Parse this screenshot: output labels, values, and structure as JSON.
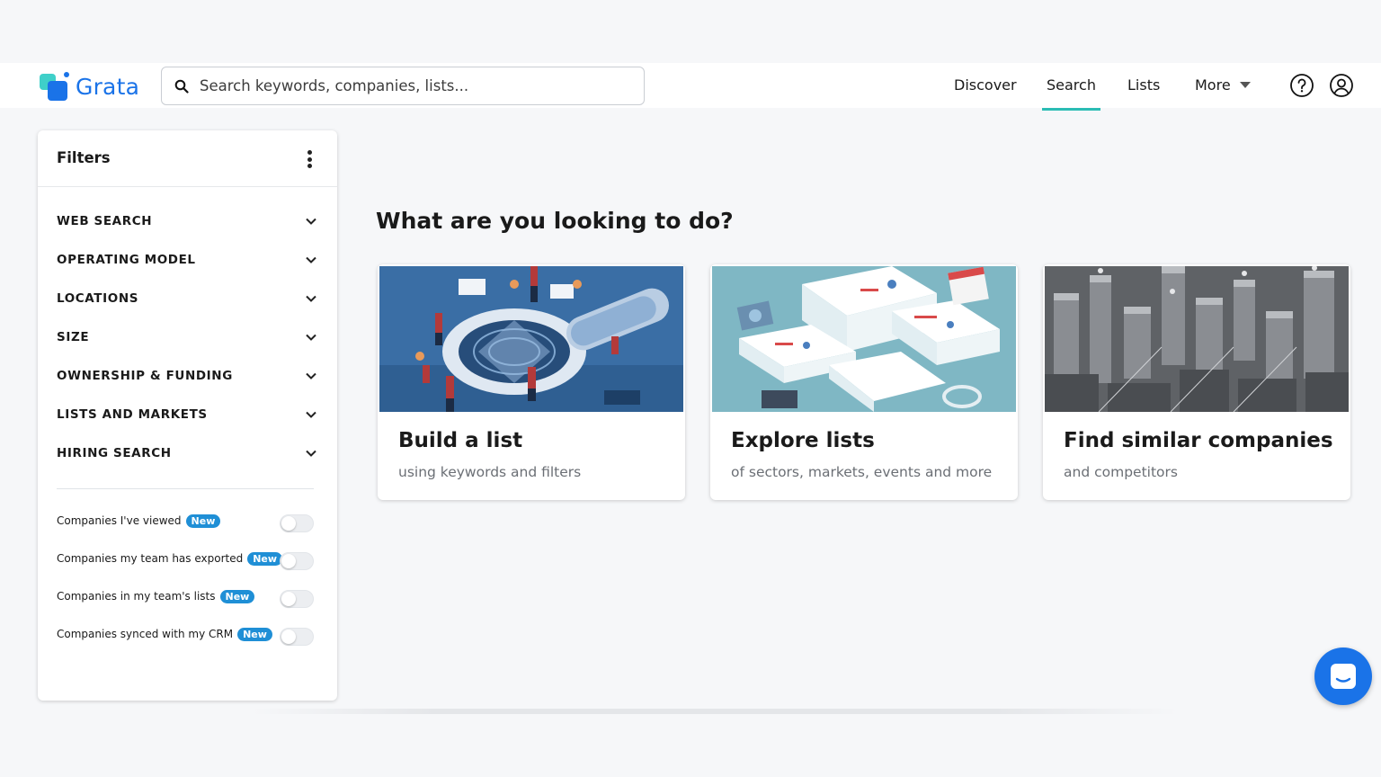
{
  "app": {
    "logo_text": "Grata"
  },
  "search": {
    "placeholder": "Search keywords, companies, lists..."
  },
  "nav": {
    "items": [
      {
        "label": "Discover"
      },
      {
        "label": "Search",
        "active": true
      },
      {
        "label": "Lists"
      },
      {
        "label": "More"
      }
    ],
    "help_icon": "question-circle-icon",
    "account_icon": "user-circle-icon"
  },
  "filters": {
    "title": "Filters",
    "sections": [
      {
        "label": "WEB SEARCH"
      },
      {
        "label": "OPERATING MODEL"
      },
      {
        "label": "LOCATIONS"
      },
      {
        "label": "SIZE"
      },
      {
        "label": "OWNERSHIP & FUNDING"
      },
      {
        "label": "LISTS AND MARKETS"
      },
      {
        "label": "HIRING SEARCH"
      }
    ],
    "toggles": [
      {
        "label": "Companies I've viewed",
        "badge": "New",
        "on": false
      },
      {
        "label": "Companies my team has exported",
        "badge": "New",
        "on": false
      },
      {
        "label": "Companies in my team's lists",
        "badge": "New",
        "on": false
      },
      {
        "label": "Companies synced with my CRM",
        "badge": "New",
        "on": false
      }
    ]
  },
  "main": {
    "heading": "What are you looking to do?",
    "cards": [
      {
        "title": "Build a list",
        "subtitle": "using keywords and filters"
      },
      {
        "title": "Explore lists",
        "subtitle": "of sectors, markets, events and more"
      },
      {
        "title": "Find similar companies",
        "subtitle": "and competitors"
      }
    ]
  },
  "colors": {
    "brand": "#1a73e8",
    "accent": "#2bbcb4",
    "badge": "#1f8fd6"
  }
}
